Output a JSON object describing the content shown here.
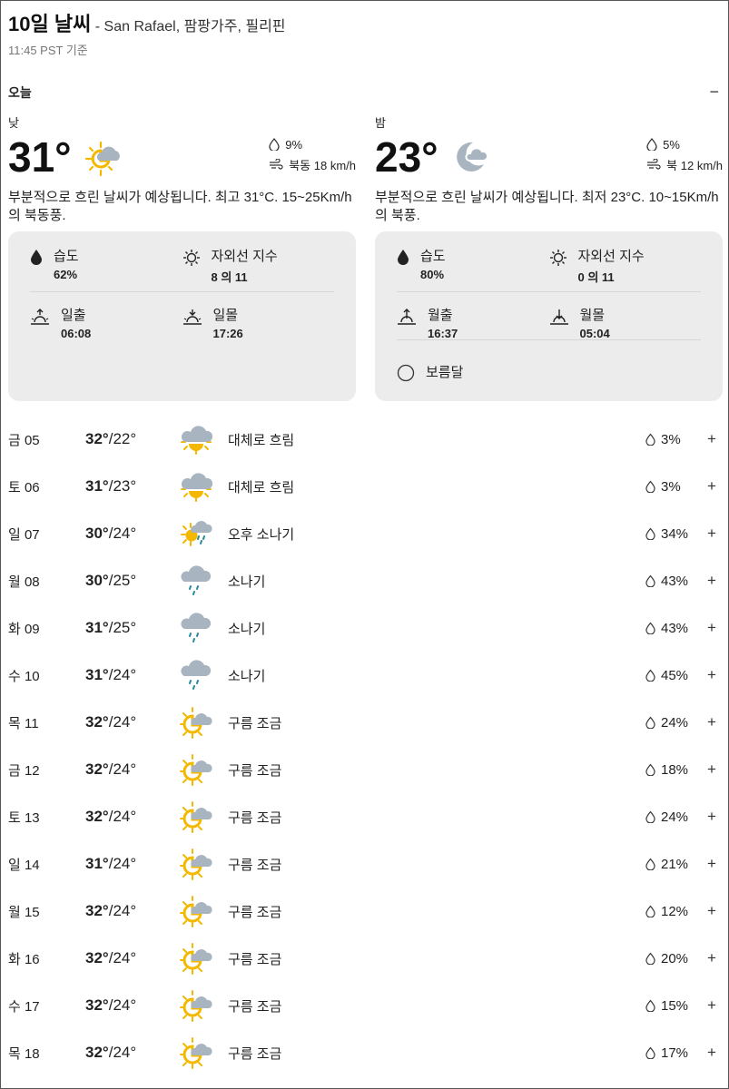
{
  "header": {
    "title": "10일 날씨",
    "location": " - San Rafael, 팜팡가주, 필리핀",
    "updated": "11:45 PST 기준"
  },
  "today": {
    "label": "오늘",
    "collapse_icon": "−",
    "day": {
      "period": "낮",
      "temp": "31°",
      "icon": "partly-sunny-icon",
      "precip": "9%",
      "wind": "북동 18 km/h",
      "description": "부분적으로 흐린 날씨가 예상됩니다. 최고 31°C. 15~25Km/h의 북동풍.",
      "humidity_label": "습도",
      "humidity": "62%",
      "uv_label": "자외선 지수",
      "uv": "8 의 11",
      "rise_label": "일출",
      "rise": "06:08",
      "set_label": "일몰",
      "set": "17:26"
    },
    "night": {
      "period": "밤",
      "temp": "23°",
      "icon": "partly-cloudy-night-icon",
      "precip": "5%",
      "wind": "북 12 km/h",
      "description": "부분적으로 흐린 날씨가 예상됩니다. 최저 23°C. 10~15Km/h의 북풍.",
      "humidity_label": "습도",
      "humidity": "80%",
      "uv_label": "자외선 지수",
      "uv": "0 의 11",
      "rise_label": "월출",
      "rise": "16:37",
      "set_label": "월몰",
      "set": "05:04",
      "moon_phase": "보름달"
    }
  },
  "forecast": [
    {
      "date": "금 05",
      "hi": "32°",
      "lo": "22°",
      "icon": "mostly-cloudy-day-icon",
      "desc": "대체로 흐림",
      "precip": "3%"
    },
    {
      "date": "토 06",
      "hi": "31°",
      "lo": "23°",
      "icon": "mostly-cloudy-day-icon",
      "desc": "대체로 흐림",
      "precip": "3%"
    },
    {
      "date": "일 07",
      "hi": "30°",
      "lo": "24°",
      "icon": "scattered-showers-icon",
      "desc": "오후 소나기",
      "precip": "34%"
    },
    {
      "date": "월 08",
      "hi": "30°",
      "lo": "25°",
      "icon": "rain-icon",
      "desc": "소나기",
      "precip": "43%"
    },
    {
      "date": "화 09",
      "hi": "31°",
      "lo": "25°",
      "icon": "rain-icon",
      "desc": "소나기",
      "precip": "43%"
    },
    {
      "date": "수 10",
      "hi": "31°",
      "lo": "24°",
      "icon": "rain-icon",
      "desc": "소나기",
      "precip": "45%"
    },
    {
      "date": "목 11",
      "hi": "32°",
      "lo": "24°",
      "icon": "partly-sunny-icon",
      "desc": "구름 조금",
      "precip": "24%"
    },
    {
      "date": "금 12",
      "hi": "32°",
      "lo": "24°",
      "icon": "partly-sunny-icon",
      "desc": "구름 조금",
      "precip": "18%"
    },
    {
      "date": "토 13",
      "hi": "32°",
      "lo": "24°",
      "icon": "partly-sunny-icon",
      "desc": "구름 조금",
      "precip": "24%"
    },
    {
      "date": "일 14",
      "hi": "31°",
      "lo": "24°",
      "icon": "partly-sunny-icon",
      "desc": "구름 조금",
      "precip": "21%"
    },
    {
      "date": "월 15",
      "hi": "32°",
      "lo": "24°",
      "icon": "partly-sunny-icon",
      "desc": "구름 조금",
      "precip": "12%"
    },
    {
      "date": "화 16",
      "hi": "32°",
      "lo": "24°",
      "icon": "partly-sunny-icon",
      "desc": "구름 조금",
      "precip": "20%"
    },
    {
      "date": "수 17",
      "hi": "32°",
      "lo": "24°",
      "icon": "partly-sunny-icon",
      "desc": "구름 조금",
      "precip": "15%"
    },
    {
      "date": "목 18",
      "hi": "32°",
      "lo": "24°",
      "icon": "partly-sunny-icon",
      "desc": "구름 조금",
      "precip": "17%"
    }
  ],
  "expand_icon": "+",
  "colors": {
    "sun": "#f5b800",
    "cloud": "#a8b4bf",
    "rain": "#2a8a9a",
    "card": "#ececec"
  }
}
